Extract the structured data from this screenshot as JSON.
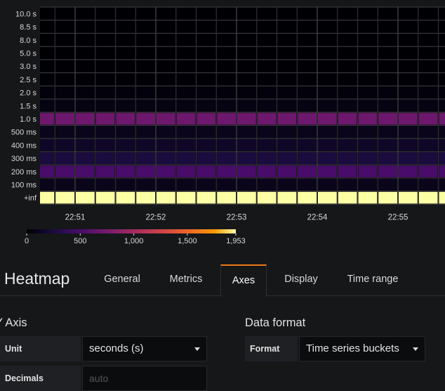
{
  "chart_data": {
    "type": "heatmap",
    "y_buckets": [
      "+inf",
      "100 ms",
      "200 ms",
      "300 ms",
      "400 ms",
      "500 ms",
      "1.0 s",
      "1.5 s",
      "2.0 s",
      "2.5 s",
      "3.0 s",
      "5.0 s",
      "8.0 s",
      "8.5 s",
      "10.0 s"
    ],
    "x_ticks": [
      "22:51",
      "22:52",
      "22:53",
      "22:54",
      "22:55"
    ],
    "columns_per_minute": 4,
    "bucket_values": {
      "+inf": 1953,
      "100 ms": 100,
      "200 ms": 500,
      "300 ms": 250,
      "400 ms": 150,
      "500 ms": 100,
      "1.0 s": 700,
      "1.5 s": 60,
      "2.0 s": 30,
      "2.5 s": 10,
      "3.0 s": 5,
      "5.0 s": 0,
      "8.0 s": 0,
      "8.5 s": 0,
      "10.0 s": 0
    },
    "color_scale": {
      "min": 0,
      "max": 1953,
      "ticks": [
        "0",
        "500",
        "1,000",
        "1,500",
        "1,953"
      ],
      "scheme": "inferno"
    }
  },
  "panel": {
    "title": "Heatmap",
    "tabs": [
      {
        "label": "General"
      },
      {
        "label": "Metrics"
      },
      {
        "label": "Axes"
      },
      {
        "label": "Display"
      },
      {
        "label": "Time range"
      }
    ],
    "active_tab": "Axes"
  },
  "y_axis": {
    "section_title": "Y Axis",
    "unit_label": "Unit",
    "unit_value": "seconds (s)",
    "decimals_label": "Decimals",
    "decimals_placeholder": "auto"
  },
  "data_format": {
    "section_title": "Data format",
    "format_label": "Format",
    "format_value": "Time series buckets"
  },
  "colors": {
    "accent": "#eb7b18",
    "background": "#161719"
  }
}
